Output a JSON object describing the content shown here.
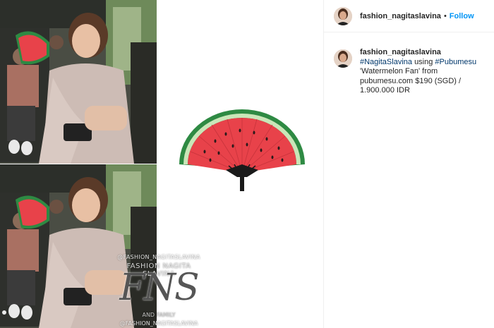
{
  "post": {
    "username": "fashion_nagitaslavina",
    "separator": "•",
    "follow_label": "Follow"
  },
  "caption": {
    "username": "fashion_nagitaslavina",
    "hashtag1": "#NagitaSlavina",
    "text1": "using",
    "hashtag2": "#Pubumesu",
    "text2": "'Watermelon Fan' from pubumesu.com $190 (SGD) / 1.900.000 IDR"
  },
  "media": {
    "watermark_handle_top": "@FASHION_NAGITASLAVINA",
    "watermark_line": "FASHION NAGITA SLAVINA",
    "watermark_logo": "FNS",
    "watermark_family": "AND FAMILY",
    "watermark_handle_bottom": "@FASHION_NAGITASLAVINA",
    "carousel_current": 1
  },
  "colors": {
    "link_blue": "#0095f6",
    "hashtag": "#00376b",
    "watermelon_flesh": "#e8424a",
    "watermelon_rind": "#2e8a43"
  },
  "icons": {
    "avatar": "profile-photo",
    "fan": "watermelon-fan-product"
  }
}
